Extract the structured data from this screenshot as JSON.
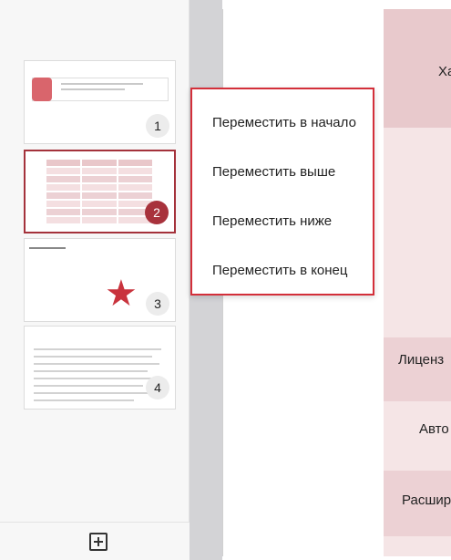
{
  "thumbnails": [
    {
      "number": "1"
    },
    {
      "number": "2"
    },
    {
      "number": "3"
    },
    {
      "number": "4"
    }
  ],
  "context_menu": {
    "items": [
      "Переместить в начало",
      "Переместить выше",
      "Переместить ниже",
      "Переместить в конец"
    ]
  },
  "slide": {
    "header_partial": "Ха",
    "row_license": "Лиценз",
    "row_auto": "Авто",
    "row_expand": "Расшир"
  },
  "colors": {
    "accent": "#a8323c",
    "menu_border": "#d32f3a",
    "star": "#c9333d"
  },
  "icons": {
    "add_slide": "add-slide-icon",
    "star": "star-shape"
  }
}
